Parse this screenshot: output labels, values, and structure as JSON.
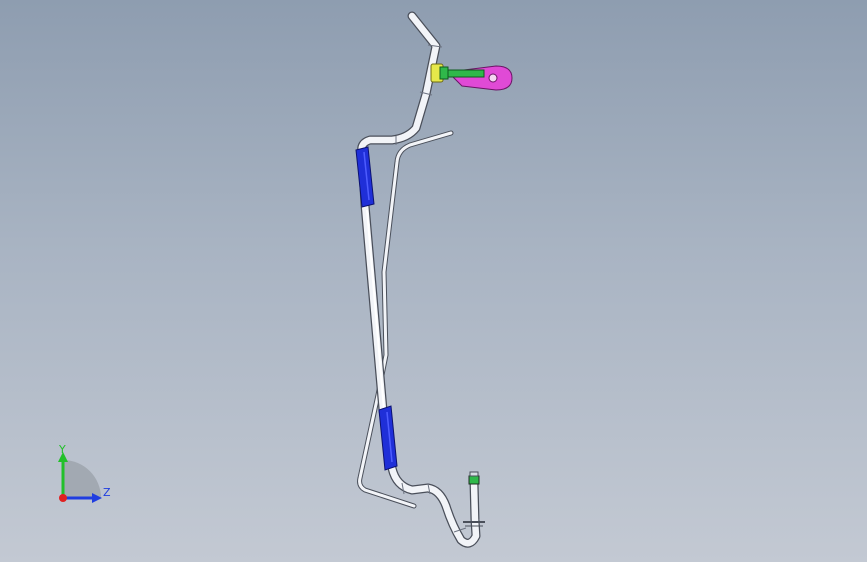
{
  "viewport": {
    "background_top": "#8e9db0",
    "background_bottom": "#c3c9d3"
  },
  "model": {
    "tube_color": "#f2f4f8",
    "tube_edge": "#4a4f5a",
    "sleeve_color": "#1f2fd8",
    "bracket_color": "#e04ad6",
    "clamp_color": "#e6e84a",
    "bolt_color": "#2fb84a"
  },
  "triad": {
    "y_label": "Y",
    "z_label": "Z",
    "y_color": "#22c02a",
    "z_color": "#1f3de0",
    "origin_color": "#e02020"
  }
}
